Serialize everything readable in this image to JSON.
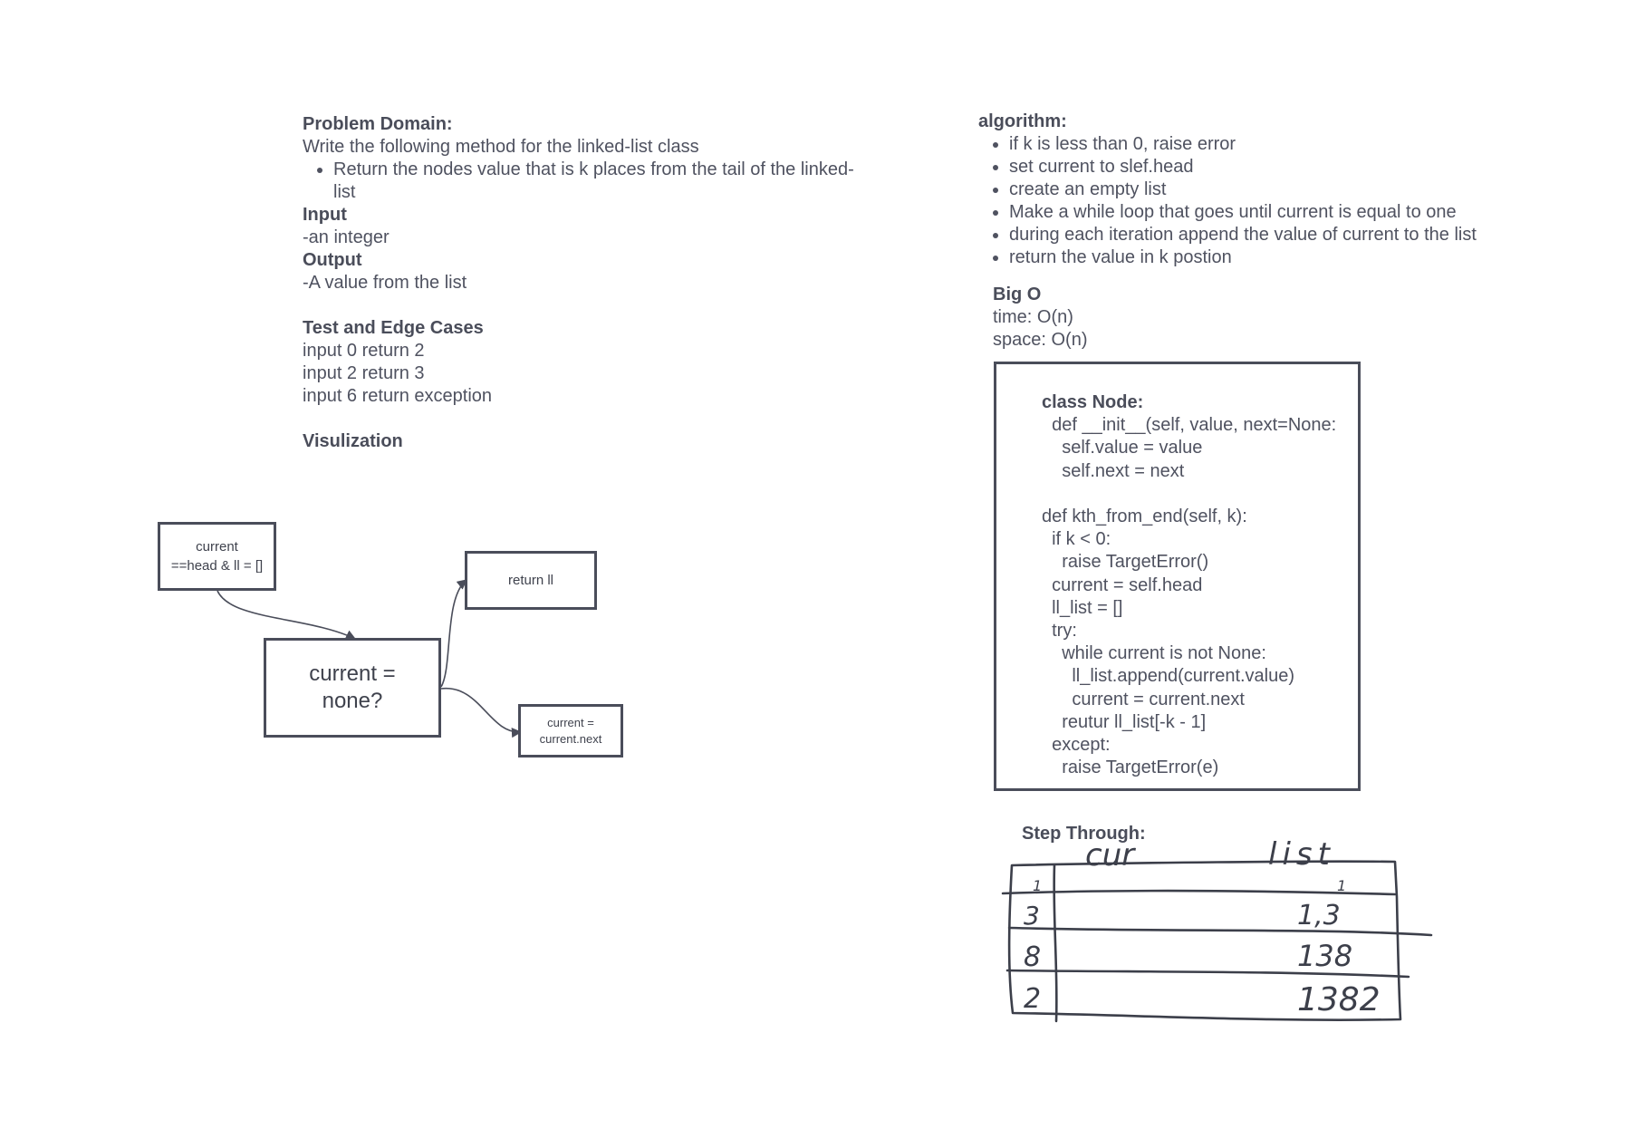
{
  "problem": {
    "heading": "Problem Domain:",
    "description": "Write the following method for the linked-list class",
    "bullet_line1": "Return the nodes value that is k places from the tail of the linked-",
    "bullet_line2": "list",
    "input_heading": "Input",
    "input_value": "-an integer",
    "output_heading": "Output",
    "output_value": "-A value from the list",
    "tests_heading": "Test and Edge Cases",
    "tests": [
      "input 0 return 2",
      "input 2 return 3",
      "input 6 return exception"
    ],
    "visualization_heading": "Visulization"
  },
  "flow": {
    "start_line1": "current",
    "start_line2": "==head & ll = []",
    "decision_line1": "current =",
    "decision_line2": "none?",
    "return_box": "return ll",
    "advance_line1": "current =",
    "advance_line2": "current.next"
  },
  "algorithm": {
    "heading": "algorithm:",
    "steps": [
      "if k is less than 0, raise error",
      "set current to slef.head",
      "create an empty list",
      "Make a while loop that goes until current is equal to one",
      "during each iteration append the value of current to the list",
      "return the value in k postion"
    ]
  },
  "big_o": {
    "heading": "Big O",
    "time": "time: O(n)",
    "space": "space: O(n)"
  },
  "code": {
    "lines": [
      "class Node:",
      "  def __init__(self, value, next=None:",
      "    self.value = value",
      "    self.next = next",
      "",
      "def kth_from_end(self, k):",
      "  if k < 0:",
      "    raise TargetError()",
      "  current = self.head",
      "  ll_list = []",
      "  try:",
      "    while current is not None:",
      "      ll_list.append(current.value)",
      "      current = current.next",
      "    reutur ll_list[-k - 1]",
      "  except:",
      "    raise TargetError(e)"
    ]
  },
  "step_through": {
    "heading": "Step Through:",
    "col_cur": "cur",
    "col_list": "list",
    "rows": [
      {
        "cur": "1",
        "list": "1"
      },
      {
        "cur": "3",
        "list": "1,3"
      },
      {
        "cur": "8",
        "list": "138"
      },
      {
        "cur": "2",
        "list": "1382"
      }
    ]
  }
}
